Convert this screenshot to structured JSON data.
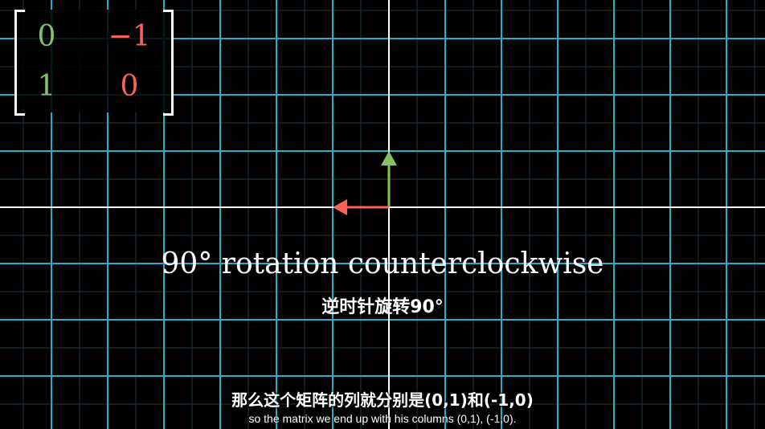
{
  "matrix": {
    "row1": [
      "0",
      "−1"
    ],
    "row2": [
      "1",
      "0"
    ],
    "colors": {
      "first_column": "#83c167",
      "second_column": "#fc6255"
    }
  },
  "captions": {
    "english": "90° rotation counterclockwise",
    "chinese": "逆时针旋转90°"
  },
  "subtitles": {
    "chinese": "那么这个矩阵的列就分别是(0,1)和(-1,0)",
    "english": "so the matrix we end up with his columns (0,1), (-1,0)."
  },
  "vectors": {
    "i_hat": {
      "x": 0,
      "y": 1,
      "color": "#83c167"
    },
    "j_hat": {
      "x": -1,
      "y": 0,
      "color": "#fc6255"
    }
  },
  "colors": {
    "grid_major": "#29abca",
    "grid_minor": "#1f3a44",
    "axes": "#ffffff",
    "background": "#000000"
  }
}
